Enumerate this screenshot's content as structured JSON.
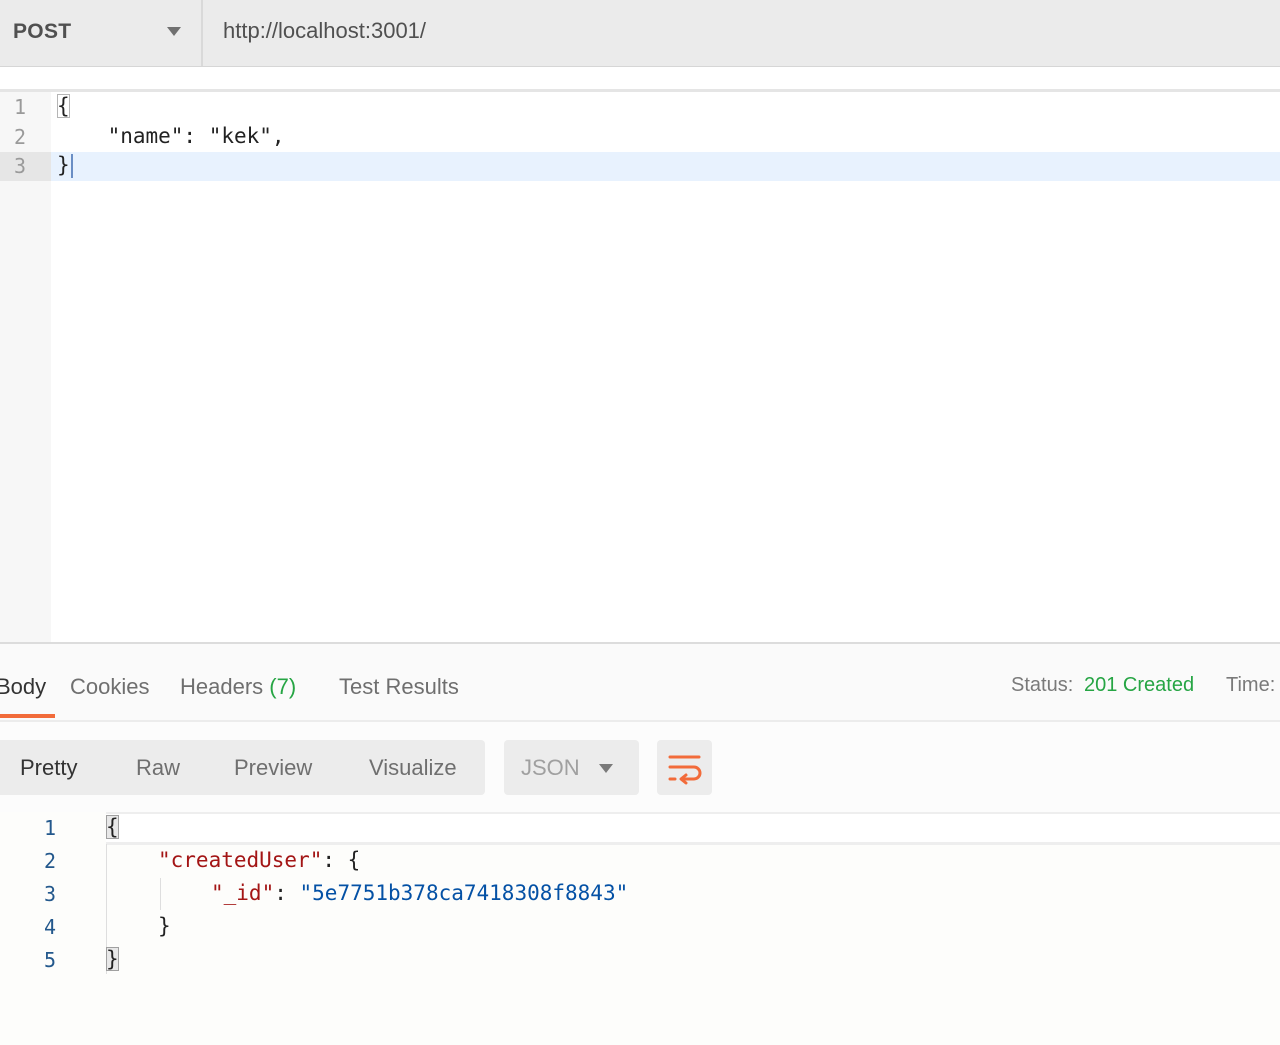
{
  "request": {
    "method": "POST",
    "url": "http://localhost:3001/",
    "body_lines": [
      {
        "num": "1",
        "text": "{"
      },
      {
        "num": "2",
        "text": "    \"name\": \"kek\","
      },
      {
        "num": "3",
        "text": "}"
      }
    ]
  },
  "response_tabs": {
    "body": "Body",
    "cookies": "Cookies",
    "headers": "Headers",
    "headers_count": "(7)",
    "test_results": "Test Results"
  },
  "status": {
    "label": "Status:",
    "value": "201 Created",
    "value_color": "#26a544",
    "time_label": "Time:"
  },
  "view_modes": {
    "pretty": "Pretty",
    "raw": "Raw",
    "preview": "Preview",
    "visualize": "Visualize",
    "active": "Pretty"
  },
  "format": {
    "selected": "JSON"
  },
  "icons": {
    "method_dropdown": "chevron-down-icon",
    "format_dropdown": "chevron-down-icon",
    "wrap": "wrap-lines-icon"
  },
  "response_body": {
    "line_numbers": [
      "1",
      "2",
      "3",
      "4",
      "5"
    ],
    "open_brace": "{",
    "created_user_key": "\"createdUser\"",
    "colon_open": ": {",
    "id_key": "\"_id\"",
    "colon": ": ",
    "id_value": "\"5e7751b378ca7418308f8843\"",
    "inner_close": "}",
    "close_brace": "}"
  },
  "accent_color": "#f26b3a"
}
